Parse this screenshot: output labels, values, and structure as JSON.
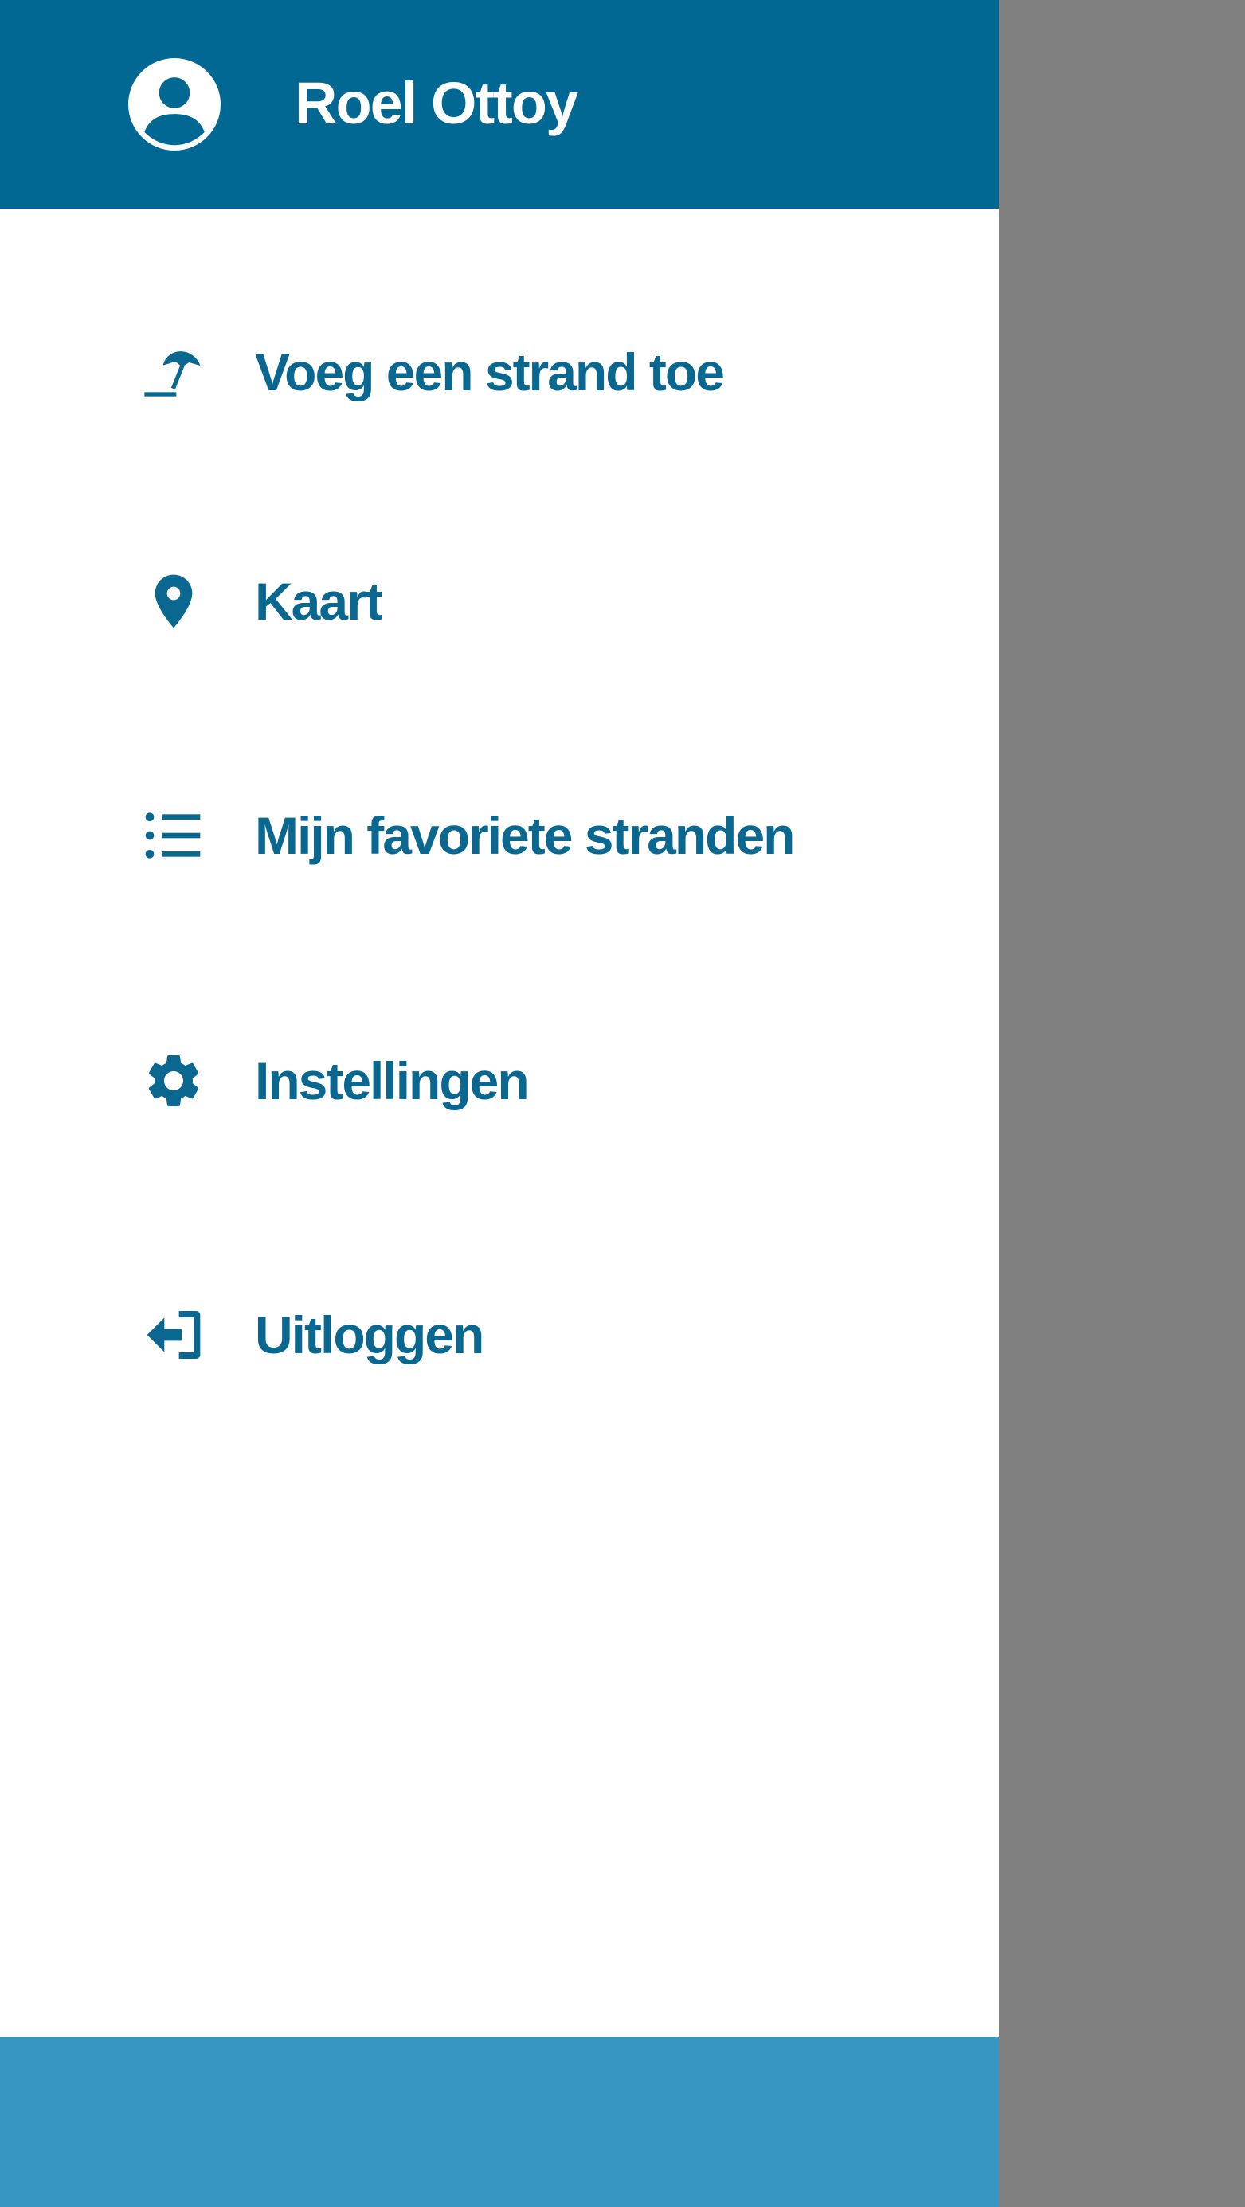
{
  "header": {
    "user_name": "Roel Ottoy",
    "avatar_icon": "account-circle-icon",
    "background_color": "#006893"
  },
  "menu": {
    "items": [
      {
        "label": "Voeg een strand toe",
        "icon": "beach-umbrella-icon"
      },
      {
        "label": "Kaart",
        "icon": "map-pin-icon"
      },
      {
        "label": "Mijn favoriete stranden",
        "icon": "list-icon"
      },
      {
        "label": "Instellingen",
        "icon": "gear-icon"
      },
      {
        "label": "Uitloggen",
        "icon": "logout-icon"
      }
    ],
    "text_color": "#0a6790"
  },
  "footer": {
    "background_color": "#3896c2"
  },
  "overlay": {
    "color": "#808080"
  }
}
